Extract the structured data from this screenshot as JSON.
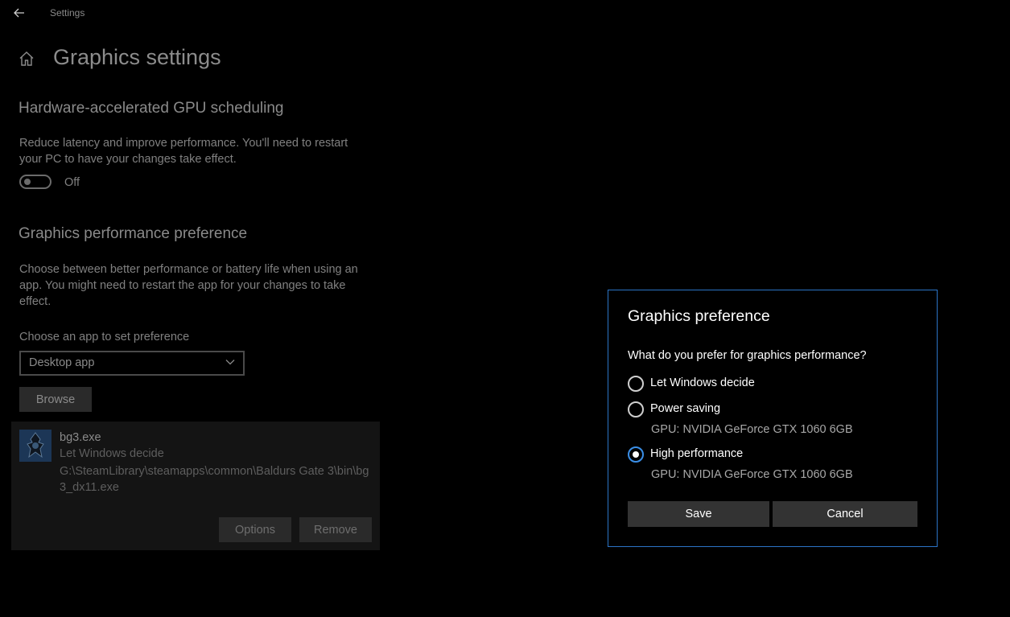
{
  "titlebar": {
    "title": "Settings",
    "back_icon": "arrow-left"
  },
  "page": {
    "title": "Graphics settings",
    "home_icon": "home"
  },
  "gpu_scheduling": {
    "heading": "Hardware-accelerated GPU scheduling",
    "description_line1": "Reduce latency and improve performance. You'll need to restart",
    "description_line2": "your PC to have your changes take effect.",
    "toggle_state": "Off"
  },
  "perf_pref": {
    "heading": "Graphics performance preference",
    "description_line1": "Choose between better performance or battery life when using an",
    "description_line2": "app. You might need to restart the app for your changes to take",
    "description_line3": "effect.",
    "choose_label": "Choose an app to set preference",
    "dropdown_value": "Desktop app",
    "browse_label": "Browse"
  },
  "app_entry": {
    "name": "bg3.exe",
    "preference": "Let Windows decide",
    "path": "G:\\SteamLibrary\\steamapps\\common\\Baldurs Gate 3\\bin\\bg3_dx11.exe",
    "options_label": "Options",
    "remove_label": "Remove"
  },
  "dialog": {
    "title": "Graphics preference",
    "question": "What do you prefer for graphics performance?",
    "options": [
      {
        "label": "Let Windows decide",
        "gpu": "",
        "checked": false
      },
      {
        "label": "Power saving",
        "gpu": "GPU: NVIDIA GeForce GTX 1060 6GB",
        "checked": false
      },
      {
        "label": "High performance",
        "gpu": "GPU: NVIDIA GeForce GTX 1060 6GB",
        "checked": true
      }
    ],
    "save_label": "Save",
    "cancel_label": "Cancel"
  },
  "colors": {
    "accent": "#3a8ee6",
    "dialog_border": "#2b74c6",
    "background": "#000000"
  }
}
